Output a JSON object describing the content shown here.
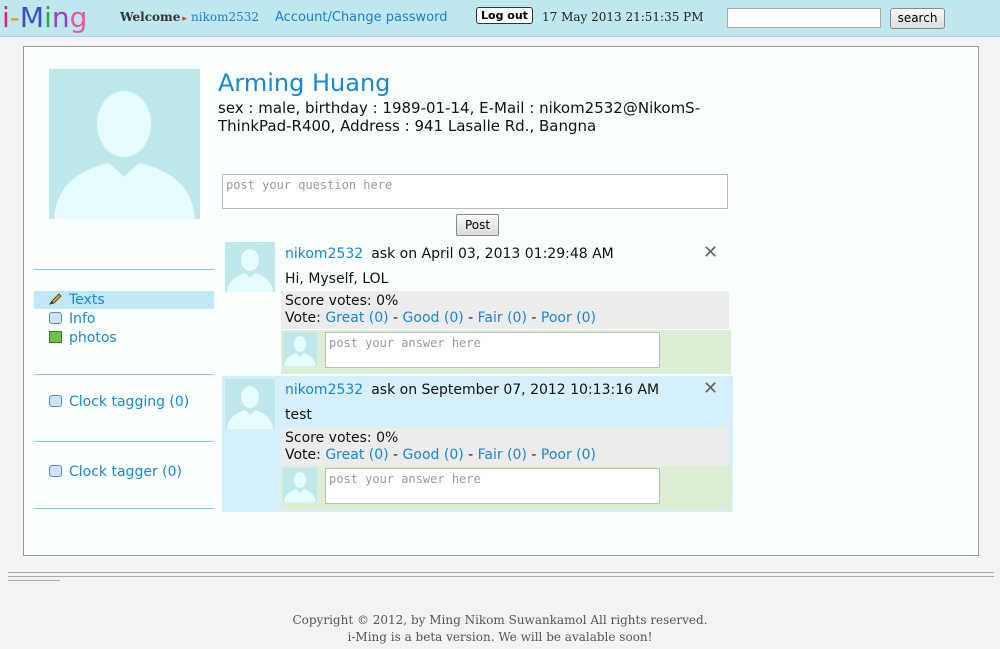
{
  "header": {
    "logo_text": "i-Ming",
    "welcome_label": "Welcome",
    "username": "nikom2532",
    "account_link": "Account/Change password",
    "logout_label": "Log out",
    "datetime": "17 May 2013 21:51:35 PM",
    "search_value": "",
    "search_button": "search"
  },
  "profile": {
    "name": "Arming Huang",
    "details": "sex : male, birthday : 1989-01-14, E-Mail : nikom2532@NikomS-ThinkPad-R400, Address : 941 Lasalle Rd., Bangna"
  },
  "question": {
    "placeholder": "post your question here",
    "post_button": "Post"
  },
  "sidebar": {
    "items": [
      {
        "label": "Texts",
        "icon": "pencil-icon"
      },
      {
        "label": "Info",
        "icon": "speech-bubble-icon"
      },
      {
        "label": "photos",
        "icon": "photo-icon"
      }
    ],
    "clock_tagging": "Clock tagging (0)",
    "clock_tagger": "Clock tagger (0)"
  },
  "posts": [
    {
      "user": "nikom2532",
      "meta": "ask on April 03, 2013 01:29:48 AM",
      "text": "Hi, Myself, LOL",
      "score": "Score votes: 0%",
      "vote_label": "Vote:",
      "votes": [
        "Great (0)",
        "Good (0)",
        "Fair (0)",
        "Poor (0)"
      ],
      "answer_placeholder": "post your answer here"
    },
    {
      "user": "nikom2532",
      "meta": "ask on September 07, 2012 10:13:16 AM",
      "text": "test",
      "score": "Score votes: 0%",
      "vote_label": "Vote:",
      "votes": [
        "Great (0)",
        "Good (0)",
        "Fair (0)",
        "Poor (0)"
      ],
      "answer_placeholder": "post your answer here"
    }
  ],
  "footer": {
    "line1": "Copyright © 2012, by Ming Nikom Suwankamol All rights reserved.",
    "line2": "i-Ming is a beta version. We will be avalable soon!"
  },
  "colors": {
    "topbar": "#bfe7ee",
    "link": "#1a86d6",
    "avatar_bg": "#bfe8eb"
  }
}
